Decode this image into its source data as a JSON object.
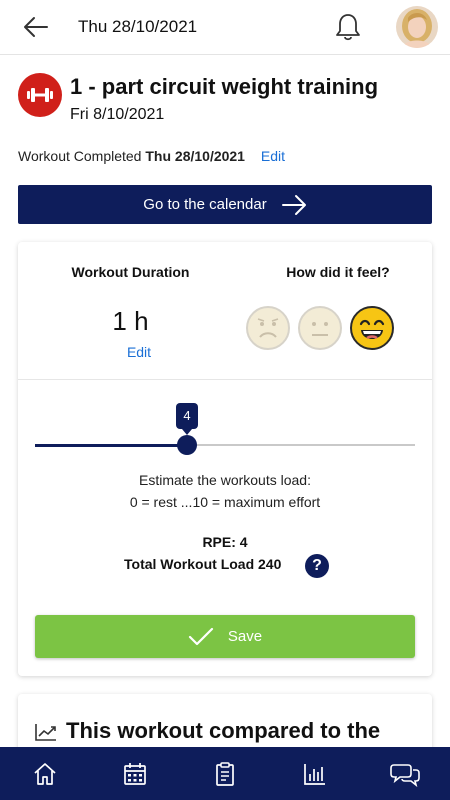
{
  "header": {
    "date": "Thu 28/10/2021",
    "back_icon": "arrow-left-icon",
    "notification_icon": "bell-icon"
  },
  "workout": {
    "title": "1 - part circuit weight training",
    "scheduled_date": "Fri 8/10/2021",
    "completed_label": "Workout Completed",
    "completed_date": "Thu 28/10/2021",
    "edit_label": "Edit",
    "icon": "dumbbell-icon",
    "icon_color": "#d0201a"
  },
  "calendar_button": {
    "label": "Go to the calendar"
  },
  "card": {
    "duration_title": "Workout Duration",
    "duration_value": "1 h",
    "duration_edit": "Edit",
    "feel_title": "How did it feel?",
    "feelings": [
      {
        "icon": "sad-face-icon",
        "selected": false
      },
      {
        "icon": "neutral-face-icon",
        "selected": false
      },
      {
        "icon": "happy-face-icon",
        "selected": true
      }
    ],
    "slider": {
      "value": "4",
      "min": 0,
      "max": 10,
      "fraction": 0.4
    },
    "load_hint_line1": "Estimate the workouts load:",
    "load_hint_line2": "0 = rest ...10 = maximum effort",
    "rpe": "RPE: 4",
    "total_load": "Total Workout Load 240",
    "help_glyph": "?",
    "save_label": "Save"
  },
  "comparison": {
    "title": "This workout compared to the"
  },
  "nav": [
    "home-icon",
    "calendar-icon",
    "clipboard-icon",
    "bar-chart-icon",
    "chat-icon"
  ],
  "colors": {
    "primary": "#0e1d5b",
    "accent_green": "#7cc444",
    "link": "#1a6fd6",
    "emoji_yellow": "#f7c514"
  }
}
